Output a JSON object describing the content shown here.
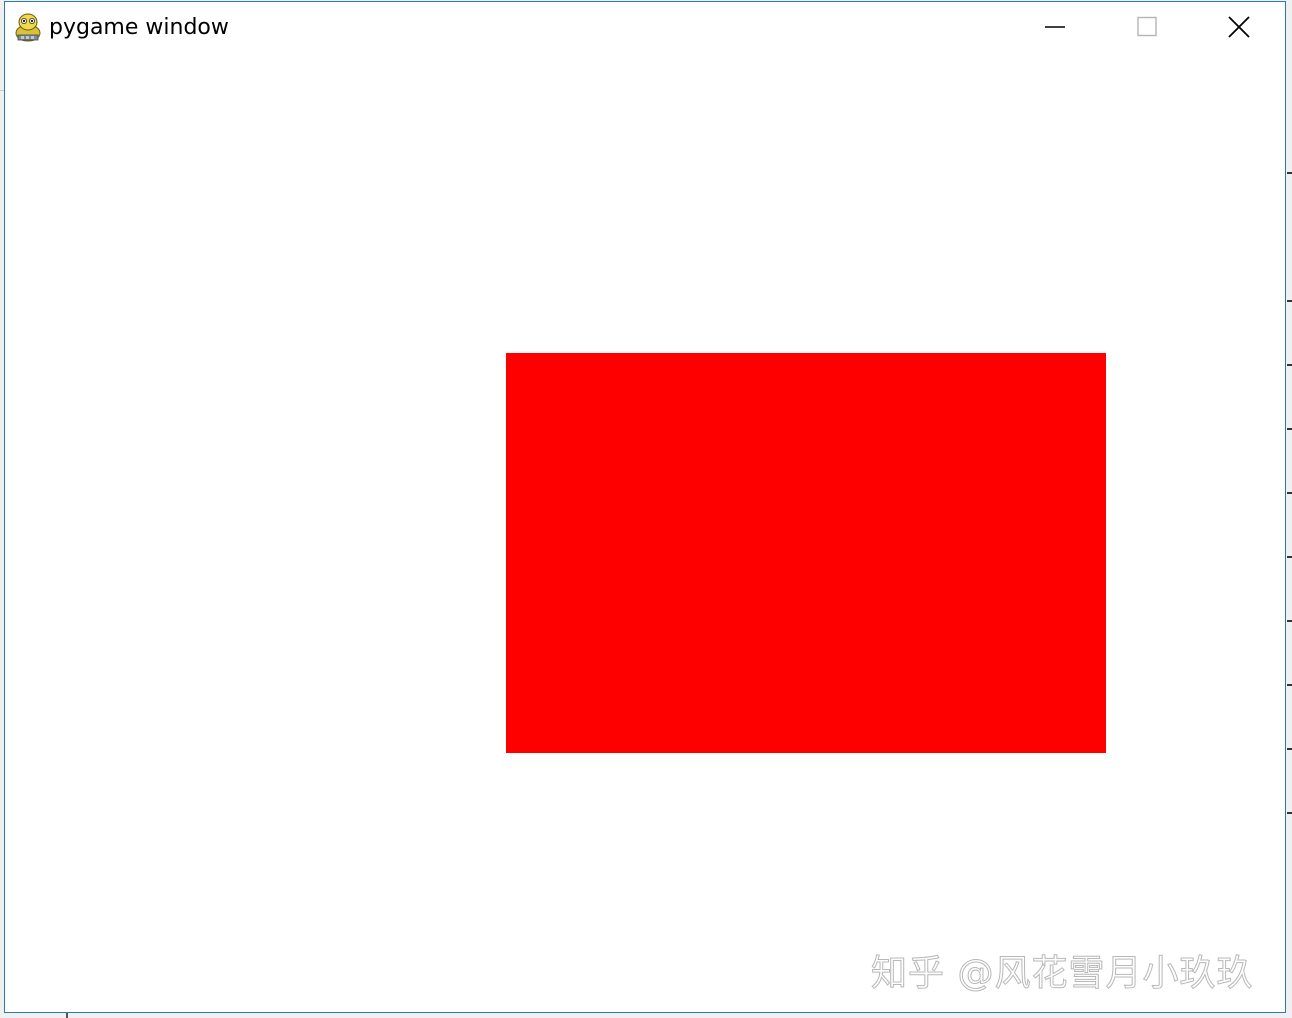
{
  "window": {
    "title": "pygame window",
    "icon": "pygame-snake-icon",
    "controls": {
      "minimize_icon": "minimize-icon",
      "maximize_icon": "maximize-icon",
      "close_icon": "close-icon"
    }
  },
  "canvas": {
    "background_color": "#ffffff",
    "shape": {
      "kind": "rectangle",
      "fill_color": "#ff0000"
    }
  },
  "watermark": {
    "text": "知乎 @风花雪月小玖玖"
  }
}
